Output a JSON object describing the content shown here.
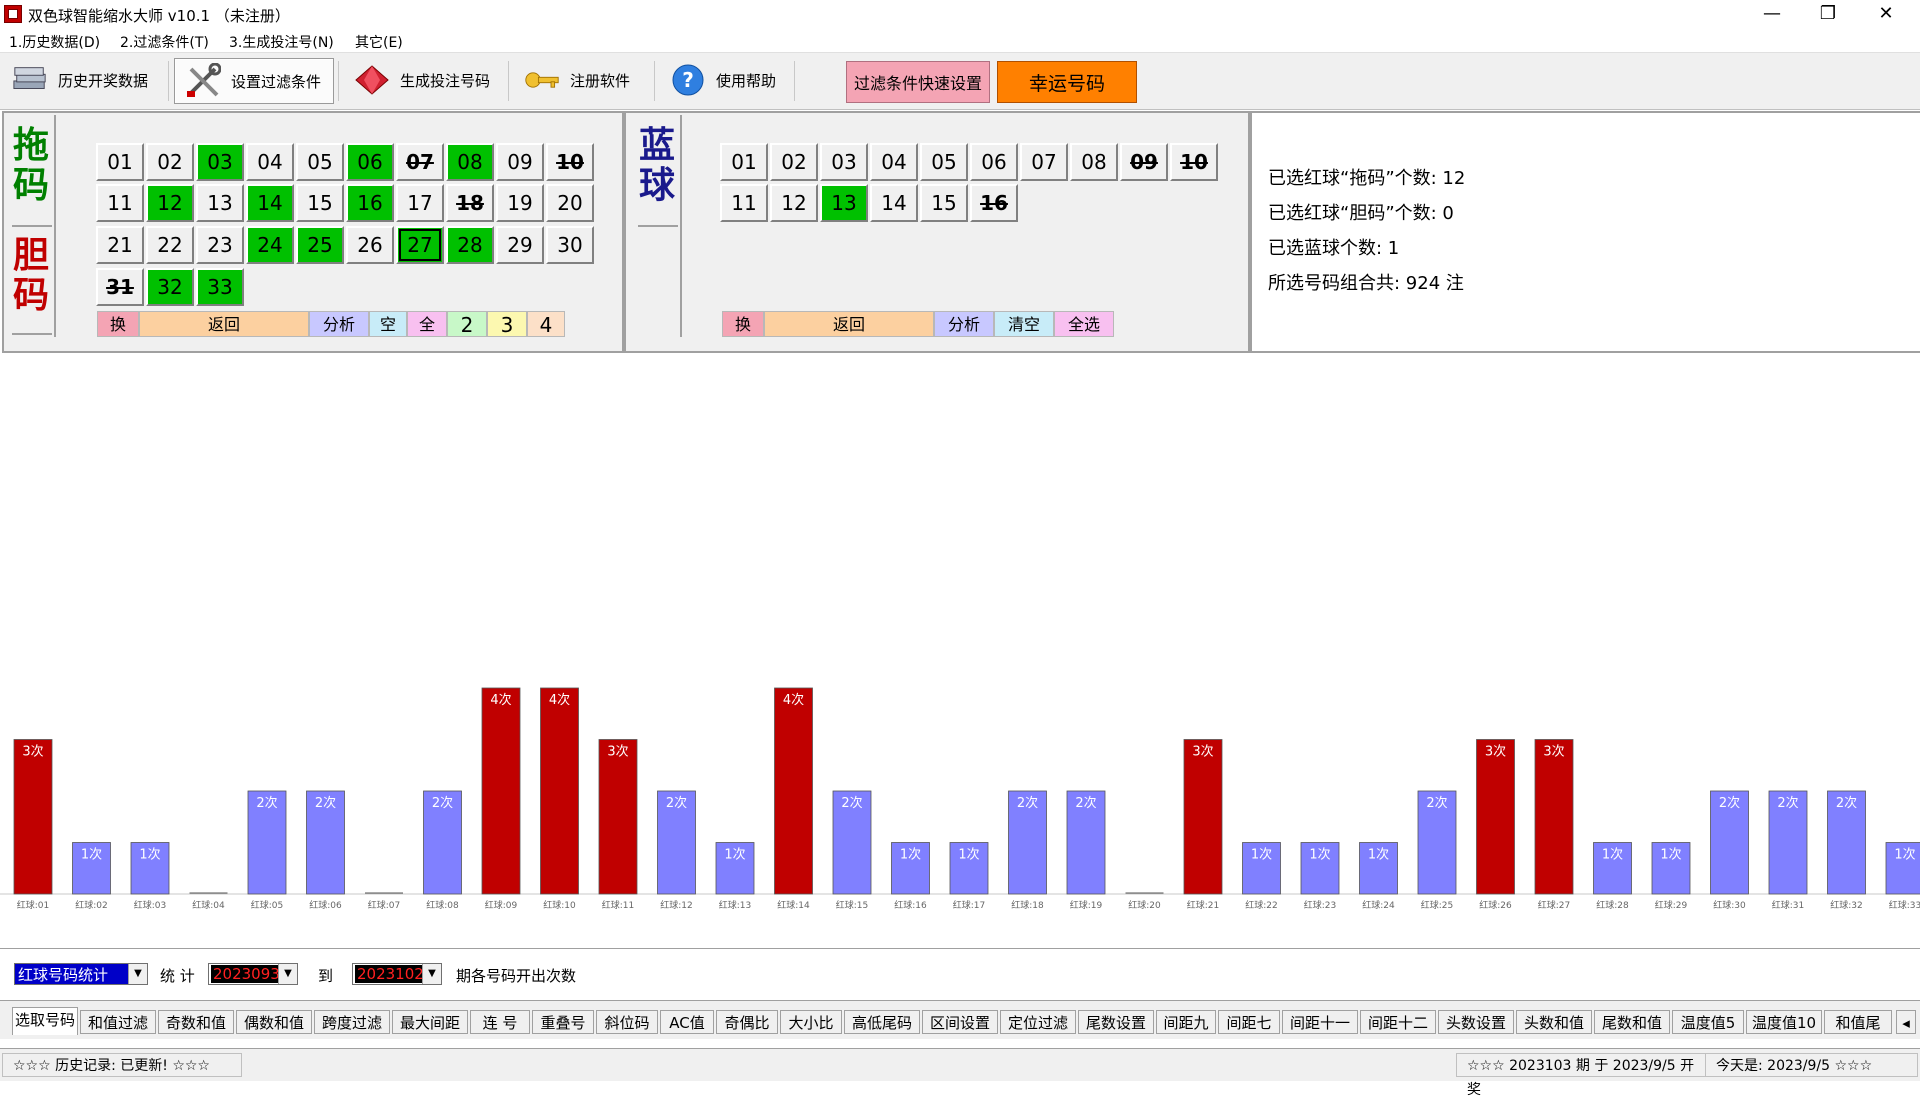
{
  "window": {
    "title": "双色球智能缩水大师 v10.1 （未注册）",
    "minimize": "—",
    "restore": "❐",
    "close": "✕"
  },
  "menu": [
    "1.历史数据(D)",
    "2.过滤条件(T)",
    "3.生成投注号(N)",
    "其它(E)"
  ],
  "toolbar": {
    "history": "历史开奖数据",
    "filter": "设置过滤条件",
    "generate": "生成投注号码",
    "register": "注册软件",
    "help": "使用帮助",
    "quick_filter": "过滤条件快速设置",
    "lucky": "幸运号码"
  },
  "red_panel": {
    "label_tuo": "拖码",
    "label_dan": "胆码",
    "balls": [
      {
        "n": "01",
        "s": "normal"
      },
      {
        "n": "02",
        "s": "normal"
      },
      {
        "n": "03",
        "s": "green"
      },
      {
        "n": "04",
        "s": "normal"
      },
      {
        "n": "05",
        "s": "normal"
      },
      {
        "n": "06",
        "s": "green"
      },
      {
        "n": "07",
        "s": "strike"
      },
      {
        "n": "08",
        "s": "green"
      },
      {
        "n": "09",
        "s": "normal"
      },
      {
        "n": "10",
        "s": "strike"
      },
      {
        "n": "11",
        "s": "normal"
      },
      {
        "n": "12",
        "s": "green"
      },
      {
        "n": "13",
        "s": "normal"
      },
      {
        "n": "14",
        "s": "green"
      },
      {
        "n": "15",
        "s": "normal"
      },
      {
        "n": "16",
        "s": "green"
      },
      {
        "n": "17",
        "s": "normal"
      },
      {
        "n": "18",
        "s": "strike"
      },
      {
        "n": "19",
        "s": "normal"
      },
      {
        "n": "20",
        "s": "normal"
      },
      {
        "n": "21",
        "s": "normal"
      },
      {
        "n": "22",
        "s": "normal"
      },
      {
        "n": "23",
        "s": "normal"
      },
      {
        "n": "24",
        "s": "green"
      },
      {
        "n": "25",
        "s": "green"
      },
      {
        "n": "26",
        "s": "normal"
      },
      {
        "n": "27",
        "s": "green-focus"
      },
      {
        "n": "28",
        "s": "green"
      },
      {
        "n": "29",
        "s": "normal"
      },
      {
        "n": "30",
        "s": "normal"
      },
      {
        "n": "31",
        "s": "strike"
      },
      {
        "n": "32",
        "s": "green"
      },
      {
        "n": "33",
        "s": "green"
      }
    ],
    "controls": {
      "swap": "换",
      "back": "返回",
      "analyze": "分析",
      "clear": "空",
      "all": "全",
      "n2": "2",
      "n3": "3",
      "n4": "4"
    }
  },
  "blue_panel": {
    "label": "蓝球",
    "balls": [
      {
        "n": "01",
        "s": "normal"
      },
      {
        "n": "02",
        "s": "normal"
      },
      {
        "n": "03",
        "s": "normal"
      },
      {
        "n": "04",
        "s": "normal"
      },
      {
        "n": "05",
        "s": "normal"
      },
      {
        "n": "06",
        "s": "normal"
      },
      {
        "n": "07",
        "s": "normal"
      },
      {
        "n": "08",
        "s": "normal"
      },
      {
        "n": "09",
        "s": "strike"
      },
      {
        "n": "10",
        "s": "strike"
      },
      {
        "n": "11",
        "s": "normal"
      },
      {
        "n": "12",
        "s": "normal"
      },
      {
        "n": "13",
        "s": "green"
      },
      {
        "n": "14",
        "s": "normal"
      },
      {
        "n": "15",
        "s": "normal"
      },
      {
        "n": "16",
        "s": "strike"
      }
    ],
    "controls": {
      "swap": "换",
      "back": "返回",
      "analyze": "分析",
      "clear": "清空",
      "all": "全选"
    }
  },
  "info": {
    "tuo_count": "已选红球“拖码”个数:  12",
    "dan_count": "已选红球“胆码”个数:  0",
    "blue_count": "已选蓝球个数:  1",
    "combos": "所选号码组合共:  924  注"
  },
  "chart_data": {
    "type": "bar",
    "categories": [
      "红球:01",
      "红球:02",
      "红球:03",
      "红球:04",
      "红球:05",
      "红球:06",
      "红球:07",
      "红球:08",
      "红球:09",
      "红球:10",
      "红球:11",
      "红球:12",
      "红球:13",
      "红球:14",
      "红球:15",
      "红球:16",
      "红球:17",
      "红球:18",
      "红球:19",
      "红球:20",
      "红球:21",
      "红球:22",
      "红球:23",
      "红球:24",
      "红球:25",
      "红球:26",
      "红球:27",
      "红球:28",
      "红球:29",
      "红球:30",
      "红球:31",
      "红球:32",
      "红球:33"
    ],
    "values": [
      3,
      1,
      1,
      0,
      2,
      2,
      0,
      2,
      4,
      4,
      3,
      2,
      1,
      4,
      2,
      1,
      1,
      2,
      2,
      0,
      3,
      1,
      1,
      1,
      2,
      3,
      3,
      1,
      1,
      2,
      2,
      2,
      1
    ],
    "value_suffix": "次",
    "colors": {
      "high": "#c00000",
      "low": "#8080ff"
    },
    "high_threshold": 3
  },
  "stats": {
    "mode": "红球号码统计",
    "label_stat": "统 计",
    "from": "2023093",
    "label_to": "到",
    "to": "2023102",
    "label_suffix": "期各号码开出次数"
  },
  "tabs": [
    "选取号码",
    "和值过滤",
    "奇数和值",
    "偶数和值",
    "跨度过滤",
    "最大间距",
    "连 号",
    "重叠号",
    "斜位码",
    "AC值",
    "奇偶比",
    "大小比",
    "高低尾码",
    "区间设置",
    "定位过滤",
    "尾数设置",
    "间距九",
    "间距七",
    "间距十一",
    "间距十二",
    "头数设置",
    "头数和值",
    "尾数和值",
    "温度值5",
    "温度值10",
    "和值尾"
  ],
  "tab_scroll": "◂",
  "status": {
    "history": "☆☆☆  历史记录:  已更新!  ☆☆☆",
    "draw": "☆☆☆  2023103 期 于 2023/9/5 开奖",
    "today": "今天是:  2023/9/5  ☆☆☆"
  }
}
